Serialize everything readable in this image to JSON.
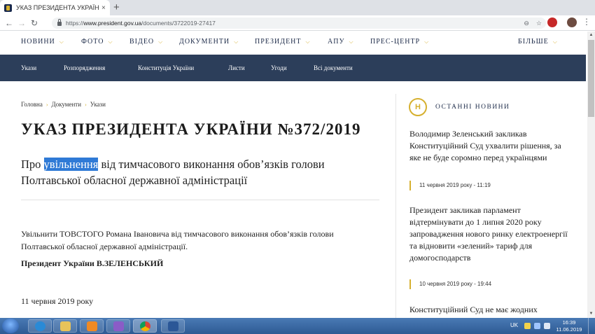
{
  "browser": {
    "tab_title": "УКАЗ ПРЕЗИДЕНТА УКРАЇНИ №",
    "tab_close": "×",
    "new_tab": "+",
    "url_prefix": "https://",
    "url_host": "www.president.gov.ua",
    "url_path": "/documents/3722019-27417",
    "icons": [
      "back-icon",
      "forward-icon",
      "reload-icon",
      "lock-icon",
      "zoom-icon",
      "star-icon",
      "menu-icon"
    ]
  },
  "topnav": {
    "items": [
      "НОВИНИ",
      "ФОТО",
      "ВІДЕО",
      "ДОКУМЕНТИ",
      "ПРЕЗИДЕНТ",
      "АПУ",
      "ПРЕС-ЦЕНТР",
      "БІЛЬШЕ"
    ]
  },
  "subnav": {
    "items": [
      "Укази",
      "Розпорядження",
      "Конституція України",
      "Листи",
      "Угоди",
      "Всі документи"
    ]
  },
  "breadcrumb": [
    "Головна",
    "Документи",
    "Укази"
  ],
  "document": {
    "title": "УКАЗ ПРЕЗИДЕНТА УКРАЇНИ №372/2019",
    "subtitle_before": "Про ",
    "subtitle_highlight": "увільнення",
    "subtitle_after": " від тимчасового виконання обов’язків голови Полтавської обласної державної адміністрації",
    "body": "Увільнити ТОВСТОГО Романа Івановича від тимчасового виконання обов’язків голови Полтавської обласної державної адміністрації.",
    "signature": "Президент України В.ЗЕЛЕНСЬКИЙ",
    "date": "11 червня 2019 року"
  },
  "sidebar": {
    "icon_letter": "Н",
    "heading": "ОСТАННІ НОВИНИ",
    "news": [
      {
        "title": "Володимир Зеленський закликав Конституційний Суд ухвалити рішення, за яке не буде соромно перед українцями",
        "date": "11 червня 2019 року - 11:19"
      },
      {
        "title": "Президент закликав парламент відтермінувати до 1 липня 2020 року запровадження нового ринку електроенергії та відновити «зелений» тариф для домогосподарств",
        "date": "10 червня 2019 року - 19:44"
      },
      {
        "title": "Конституційний Суд не має жодних"
      }
    ]
  },
  "taskbar": {
    "lang": "UK",
    "time": "16:39",
    "date": "11.06.2019",
    "colors": {
      "ie": "#2a8ad6",
      "explorer": "#e8c35a",
      "media": "#f08a24",
      "vs": "#8a5cc7",
      "chrome": "#db4437",
      "word": "#2b5797"
    }
  }
}
